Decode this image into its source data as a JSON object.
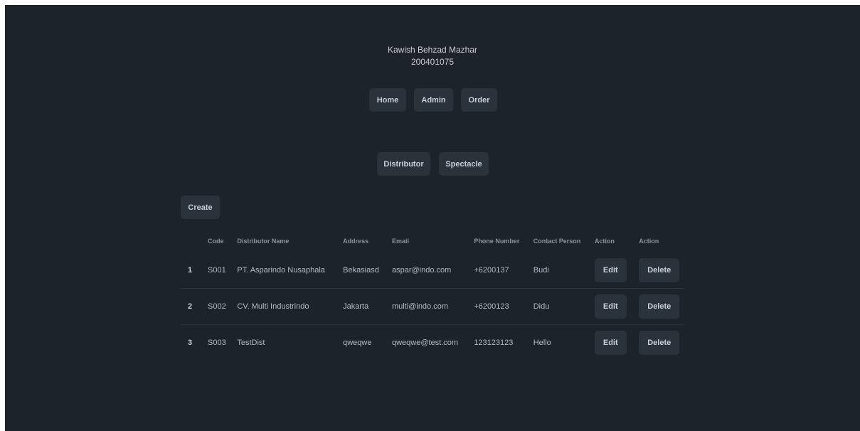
{
  "header": {
    "name": "Kawish Behzad Mazhar",
    "student_id": "200401075"
  },
  "nav": {
    "home": "Home",
    "admin": "Admin",
    "order": "Order"
  },
  "subnav": {
    "distributor": "Distributor",
    "spectacle": "Spectacle"
  },
  "create_label": "Create",
  "table": {
    "columns": [
      "",
      "Code",
      "Distributor Name",
      "Address",
      "Email",
      "Phone Number",
      "Contact Person",
      "Action",
      "Action"
    ],
    "rows": [
      {
        "index": "1",
        "code": "S001",
        "name": "PT. Asparindo Nusaphala",
        "address": "Bekasiasd",
        "email": "aspar@indo.com",
        "phone": "+6200137",
        "contact": "Budi",
        "edit": "Edit",
        "delete": "Delete"
      },
      {
        "index": "2",
        "code": "S002",
        "name": "CV. Multi Industrindo",
        "address": "Jakarta",
        "email": "multi@indo.com",
        "phone": "+6200123",
        "contact": "Didu",
        "edit": "Edit",
        "delete": "Delete"
      },
      {
        "index": "3",
        "code": "S003",
        "name": "TestDist",
        "address": "qweqwe",
        "email": "qweqwe@test.com",
        "phone": "123123123",
        "contact": "Hello",
        "edit": "Edit",
        "delete": "Delete"
      }
    ]
  },
  "colors": {
    "background": "#1d232a",
    "button": "#2a323c",
    "text": "#a6adbb"
  }
}
